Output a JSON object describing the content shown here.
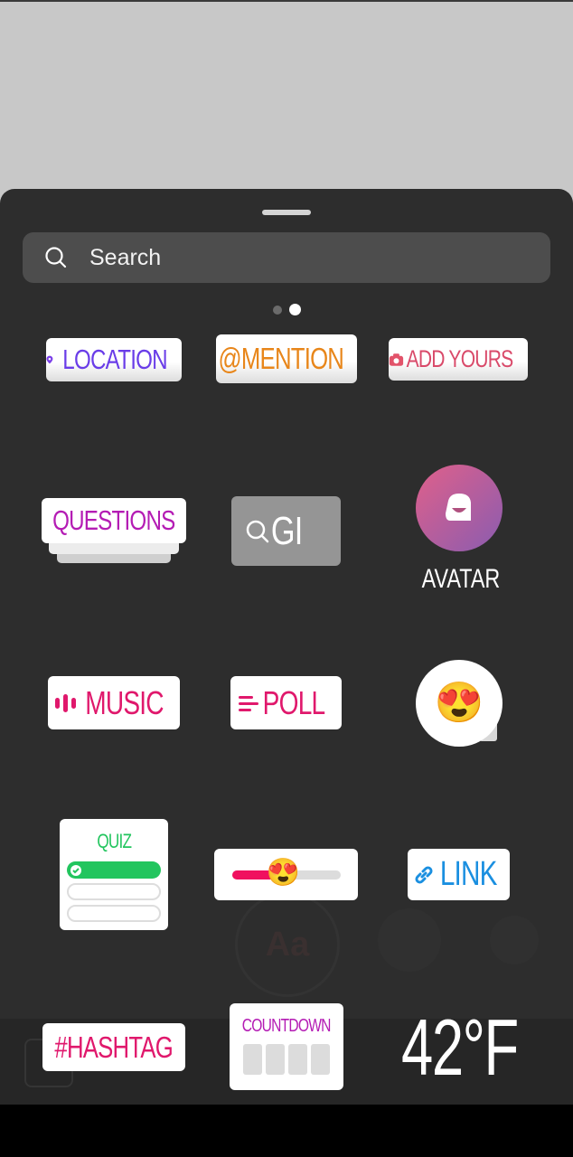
{
  "search": {
    "placeholder": "Search",
    "icon": "search-icon"
  },
  "pager": {
    "total": 2,
    "active": 2
  },
  "stickers": {
    "location": {
      "label": "LOCATION",
      "icon": "location-pin-icon",
      "color": "#6a3de8"
    },
    "mention": {
      "label": "MENTION",
      "icon": "threads-at-icon",
      "color": "#e8861a"
    },
    "add_yours": {
      "label": "ADD YOURS",
      "icon": "camera-icon",
      "color": "#d94a6a"
    },
    "questions": {
      "label": "QUESTIONS",
      "color": "#b41cb4"
    },
    "gif": {
      "label": "GI",
      "icon": "search-icon"
    },
    "avatar": {
      "label": "AVATAR",
      "icon": "avatar-face-icon"
    },
    "music": {
      "label": "MUSIC",
      "icon": "music-bars-icon",
      "color": "#e0186c"
    },
    "poll": {
      "label": "POLL",
      "icon": "poll-lines-icon",
      "color": "#e0186c"
    },
    "emoji_reaction": {
      "emoji": "😍"
    },
    "quiz": {
      "label": "QUIZ",
      "color": "#22c55e"
    },
    "emoji_slider": {
      "emoji": "😍",
      "value": 0.45
    },
    "link": {
      "label": "LINK",
      "icon": "link-icon",
      "color": "#1a8fe0"
    },
    "hashtag": {
      "label": "#HASHTAG",
      "color": "#e0186c"
    },
    "countdown": {
      "label": "COUNTDOWN",
      "color": "#b41cb4"
    },
    "temperature": {
      "label": "42°F"
    }
  },
  "background_tools": {
    "text": "Aa"
  }
}
